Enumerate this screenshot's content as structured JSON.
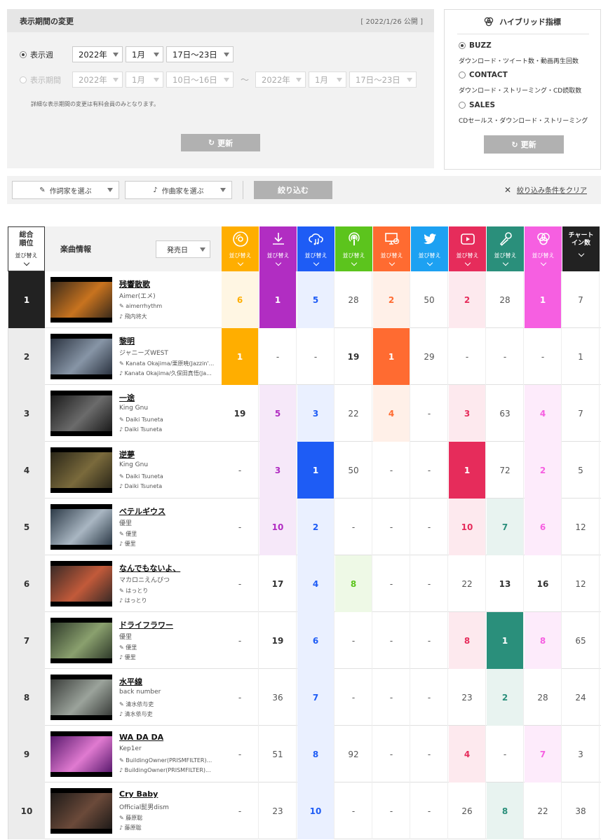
{
  "period": {
    "title": "表示期間の変更",
    "date": "[ 2022/1/26 公開 ]",
    "week_label": "表示週",
    "week_selects": [
      "2022年",
      "1月",
      "17日〜23日"
    ],
    "range_label": "表示期間",
    "range_from": [
      "2022年",
      "1月",
      "10日〜16日"
    ],
    "tilde": "〜",
    "range_to": [
      "2022年",
      "1月",
      "17日〜23日"
    ],
    "note": "詳細な表示期間の変更は有料会員のみとなります。",
    "update_label": "更新"
  },
  "hybrid": {
    "title": "ハイブリッド指標",
    "options": [
      {
        "label": "BUZZ",
        "desc": "ダウンロード・ツイート数・動画再生回数",
        "checked": true
      },
      {
        "label": "CONTACT",
        "desc": "ダウンロード・ストリーミング・CD読取数",
        "checked": false
      },
      {
        "label": "SALES",
        "desc": "CDセールス・ダウンロード・ストリーミング",
        "checked": false
      }
    ],
    "update_label": "更新"
  },
  "filter": {
    "lyricist": "作詞家を選ぶ",
    "composer": "作曲家を選ぶ",
    "narrow": "絞り込む",
    "clear": "絞り込み条件をクリア"
  },
  "table": {
    "rank_header": "総合順位",
    "sort_label": "並び替え",
    "info_header": "楽曲情報",
    "info_select": "発売日",
    "chart_header": "チャートイン数",
    "columns": [
      {
        "icon": "cd-icon",
        "color": "#ffae00",
        "tint": "#fff6e3"
      },
      {
        "icon": "download-icon",
        "color": "#b12dc2",
        "tint": "#f6e8f9"
      },
      {
        "icon": "streaming-icon",
        "color": "#1e5cf5",
        "tint": "#eaf0ff"
      },
      {
        "icon": "podcast-icon",
        "color": "#5cc41d",
        "tint": "#eef9e6"
      },
      {
        "icon": "pc-icon",
        "color": "#ff6b31",
        "tint": "#fff0e8"
      },
      {
        "icon": "twitter-icon",
        "color": "#1da1f2",
        "tint": "#eaf6fe"
      },
      {
        "icon": "youtube-icon",
        "color": "#e62c5b",
        "tint": "#fde9ee"
      },
      {
        "icon": "karaoke-icon",
        "color": "#2a8f7b",
        "tint": "#e8f3f0"
      },
      {
        "icon": "hybrid-icon",
        "color": "#f65fe1",
        "tint": "#fdebfb"
      },
      {
        "icon": "chart-icon",
        "color": "#222222",
        "tint": "#ffffff"
      }
    ],
    "rows": [
      {
        "rank": "1",
        "title": "残響散歌",
        "artist": "Aimer(エメ)",
        "lyricist": "aimerrhythm",
        "composer": "飛内将大",
        "thumb": [
          "#3a2a1a",
          "#c8731f"
        ],
        "cells": [
          "6",
          "1",
          "5",
          "28",
          "2",
          "50",
          "2",
          "28",
          "1",
          "7"
        ],
        "hl": [
          1,
          2,
          1,
          0,
          1,
          0,
          1,
          0,
          2,
          0
        ]
      },
      {
        "rank": "2",
        "title": "黎明",
        "artist": "ジャニーズWEST",
        "lyricist": "Kanata Okajima/栗原暁(Jazzin'...",
        "composer": "Kanata Okajima/久保田真悟(Ja...",
        "thumb": [
          "#2b3340",
          "#8795a6"
        ],
        "cells": [
          "1",
          "-",
          "-",
          "19",
          "1",
          "29",
          "-",
          "-",
          "-",
          "1"
        ],
        "hl": [
          2,
          0,
          0,
          0,
          2,
          0,
          0,
          0,
          0,
          0
        ]
      },
      {
        "rank": "3",
        "title": "一途",
        "artist": "King Gnu",
        "lyricist": "Daiki Tsuneta",
        "composer": "Daiki Tsuneta",
        "thumb": [
          "#1a1a1a",
          "#6b6b6b"
        ],
        "cells": [
          "19",
          "5",
          "3",
          "22",
          "4",
          "-",
          "3",
          "63",
          "4",
          "7"
        ],
        "hl": [
          0,
          1,
          1,
          0,
          1,
          0,
          1,
          0,
          1,
          0
        ]
      },
      {
        "rank": "4",
        "title": "逆夢",
        "artist": "King Gnu",
        "lyricist": "Daiki Tsuneta",
        "composer": "Daiki Tsuneta",
        "thumb": [
          "#2a2618",
          "#7a6a3c"
        ],
        "cells": [
          "-",
          "3",
          "1",
          "50",
          "-",
          "-",
          "1",
          "72",
          "2",
          "5"
        ],
        "hl": [
          0,
          1,
          2,
          0,
          0,
          0,
          2,
          0,
          1,
          0
        ]
      },
      {
        "rank": "5",
        "title": "ベテルギウス",
        "artist": "優里",
        "lyricist": "優里",
        "composer": "優里",
        "thumb": [
          "#2d3b48",
          "#a9b6c2"
        ],
        "cells": [
          "-",
          "10",
          "2",
          "-",
          "-",
          "-",
          "10",
          "7",
          "6",
          "12"
        ],
        "hl": [
          0,
          1,
          1,
          0,
          0,
          0,
          1,
          1,
          1,
          0
        ]
      },
      {
        "rank": "6",
        "title": "なんでもないよ、",
        "artist": "マカロニえんぴつ",
        "lyricist": "はっとり",
        "composer": "はっとり",
        "thumb": [
          "#3a2a26",
          "#c25a3a"
        ],
        "cells": [
          "-",
          "17",
          "4",
          "8",
          "-",
          "-",
          "22",
          "13",
          "16",
          "12"
        ],
        "hl": [
          0,
          0,
          1,
          1,
          0,
          0,
          0,
          0,
          0,
          0
        ]
      },
      {
        "rank": "7",
        "title": "ドライフラワー",
        "artist": "優里",
        "lyricist": "優里",
        "composer": "優里",
        "thumb": [
          "#2f3a2a",
          "#8aa06e"
        ],
        "cells": [
          "-",
          "19",
          "6",
          "-",
          "-",
          "-",
          "8",
          "1",
          "8",
          "65"
        ],
        "hl": [
          0,
          0,
          1,
          0,
          0,
          0,
          1,
          2,
          1,
          0
        ]
      },
      {
        "rank": "8",
        "title": "水平線",
        "artist": "back number",
        "lyricist": "清水依与吏",
        "composer": "清水依与吏",
        "thumb": [
          "#3a3d3a",
          "#9ba39b"
        ],
        "cells": [
          "-",
          "36",
          "7",
          "-",
          "-",
          "-",
          "23",
          "2",
          "28",
          "24"
        ],
        "hl": [
          0,
          0,
          1,
          0,
          0,
          0,
          0,
          1,
          0,
          0
        ]
      },
      {
        "rank": "9",
        "title": "WA DA DA",
        "artist": "Kep1er",
        "lyricist": "BuildingOwner(PRISMFILTER)...",
        "composer": "BuildingOwner(PRISMFILTER)...",
        "thumb": [
          "#5a1a6e",
          "#e07ad0"
        ],
        "cells": [
          "-",
          "51",
          "8",
          "92",
          "-",
          "-",
          "4",
          "-",
          "7",
          "3"
        ],
        "hl": [
          0,
          0,
          1,
          0,
          0,
          0,
          1,
          0,
          1,
          0
        ]
      },
      {
        "rank": "10",
        "title": "Cry Baby",
        "artist": "Official髭男dism",
        "lyricist": "藤原聡",
        "composer": "藤原聡",
        "thumb": [
          "#1e1a18",
          "#6b4a3a"
        ],
        "cells": [
          "-",
          "23",
          "10",
          "-",
          "-",
          "-",
          "26",
          "8",
          "22",
          "38"
        ],
        "hl": [
          0,
          0,
          1,
          0,
          0,
          0,
          0,
          1,
          0,
          0
        ]
      }
    ]
  }
}
